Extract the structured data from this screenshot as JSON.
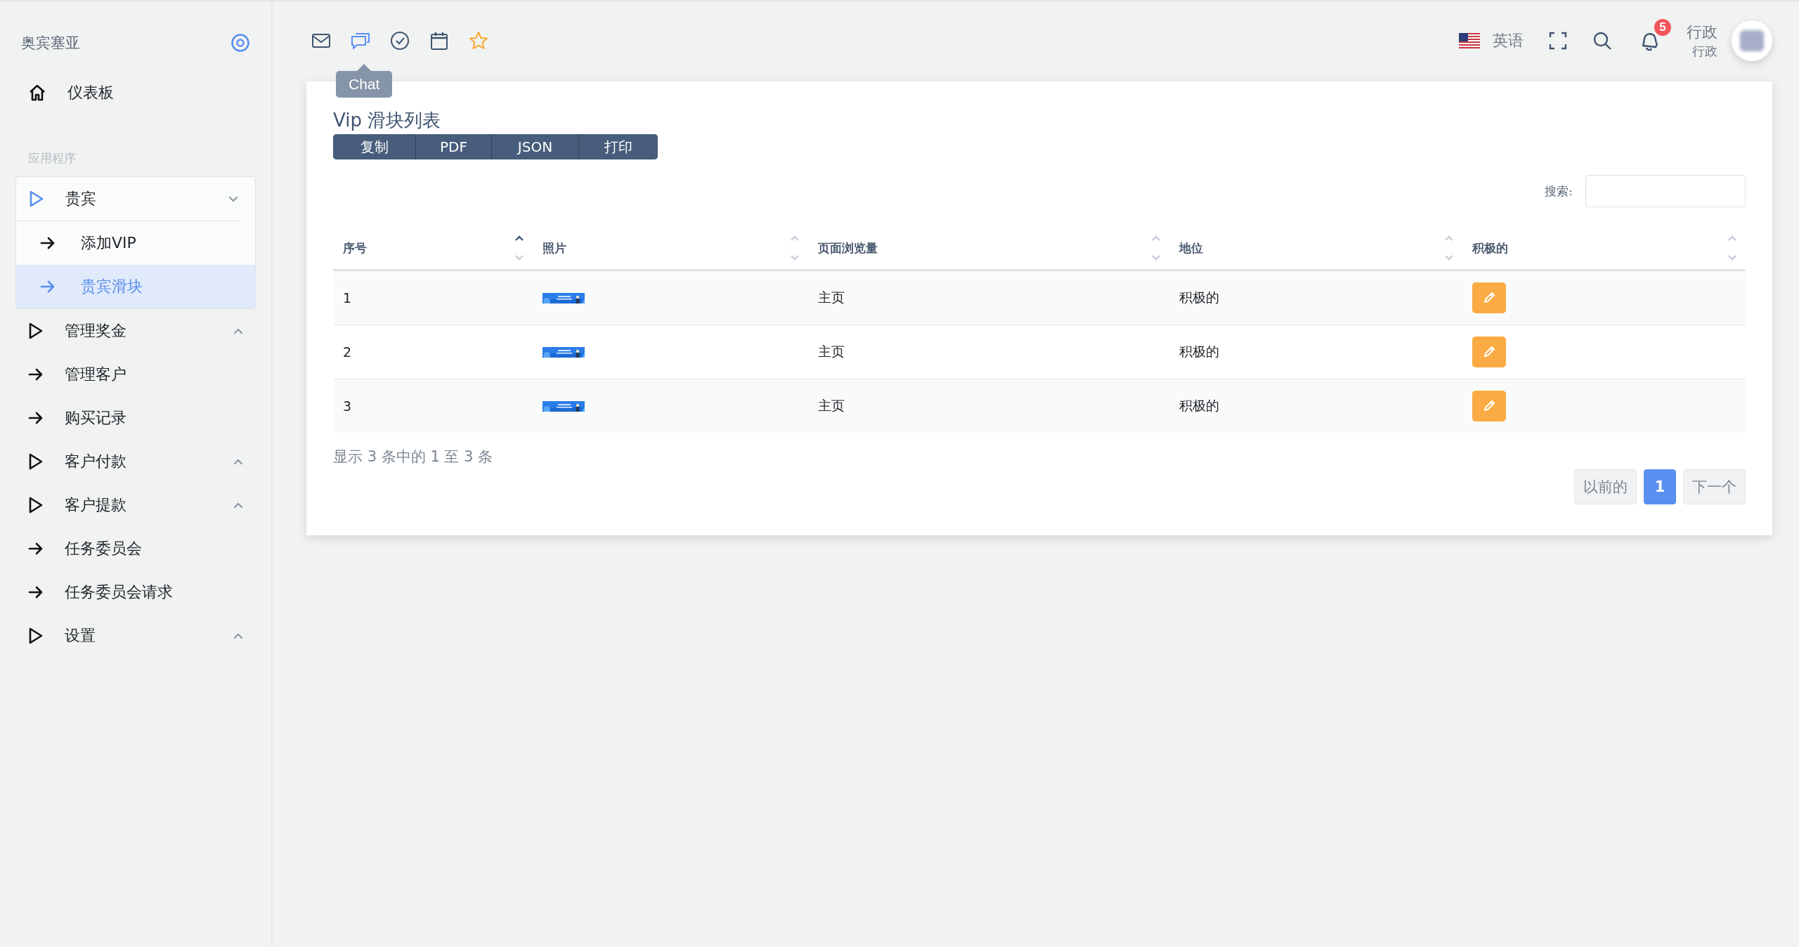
{
  "sidebar": {
    "brand": "奥宾塞亚",
    "items": [
      {
        "kind": "home",
        "label": "仪表板"
      },
      {
        "kind": "section",
        "label": "应用程序"
      },
      {
        "kind": "group",
        "label": "贵宾",
        "expanded": true,
        "children": [
          {
            "label": "添加VIP",
            "selected": false
          },
          {
            "label": "贵宾滑块",
            "selected": true
          }
        ]
      },
      {
        "kind": "group",
        "label": "管理奖金",
        "expanded": false
      },
      {
        "kind": "link",
        "label": "管理客户"
      },
      {
        "kind": "link",
        "label": "购买记录"
      },
      {
        "kind": "group",
        "label": "客户付款",
        "expanded": false
      },
      {
        "kind": "group",
        "label": "客户提款",
        "expanded": false
      },
      {
        "kind": "link",
        "label": "任务委员会"
      },
      {
        "kind": "link",
        "label": "任务委员会请求"
      },
      {
        "kind": "group",
        "label": "设置",
        "expanded": false
      }
    ]
  },
  "toolbar": {
    "apps": [
      {
        "kind": "mail",
        "selected": false
      },
      {
        "kind": "chat",
        "selected": true
      },
      {
        "kind": "check",
        "selected": false
      },
      {
        "kind": "calendar",
        "selected": false
      },
      {
        "kind": "star",
        "selected": false
      }
    ],
    "tooltip": "Chat",
    "language": "英语",
    "notifications": "5",
    "user": {
      "name": "行政",
      "role": "行政"
    }
  },
  "card": {
    "title": "Vip 滑块列表",
    "export_buttons": [
      "复制",
      "PDF",
      "JSON",
      "打印"
    ],
    "search_label": "搜索:",
    "table": {
      "columns": [
        {
          "label": "序号",
          "sorted": true
        },
        {
          "label": "照片",
          "sorted": false
        },
        {
          "label": "页面浏览量",
          "sorted": false
        },
        {
          "label": "地位",
          "sorted": false
        },
        {
          "label": "积极的",
          "sorted": false
        }
      ],
      "rows": [
        {
          "index": "1",
          "page": "主页",
          "status": "积极的"
        },
        {
          "index": "2",
          "page": "主页",
          "status": "积极的"
        },
        {
          "index": "3",
          "page": "主页",
          "status": "积极的"
        }
      ]
    },
    "info": "显示 3 条中的 1 至 3 条",
    "pagination": [
      {
        "label": "以前的",
        "selected": false
      },
      {
        "label": "1",
        "selected": true
      },
      {
        "label": "下一个",
        "selected": false
      }
    ]
  }
}
